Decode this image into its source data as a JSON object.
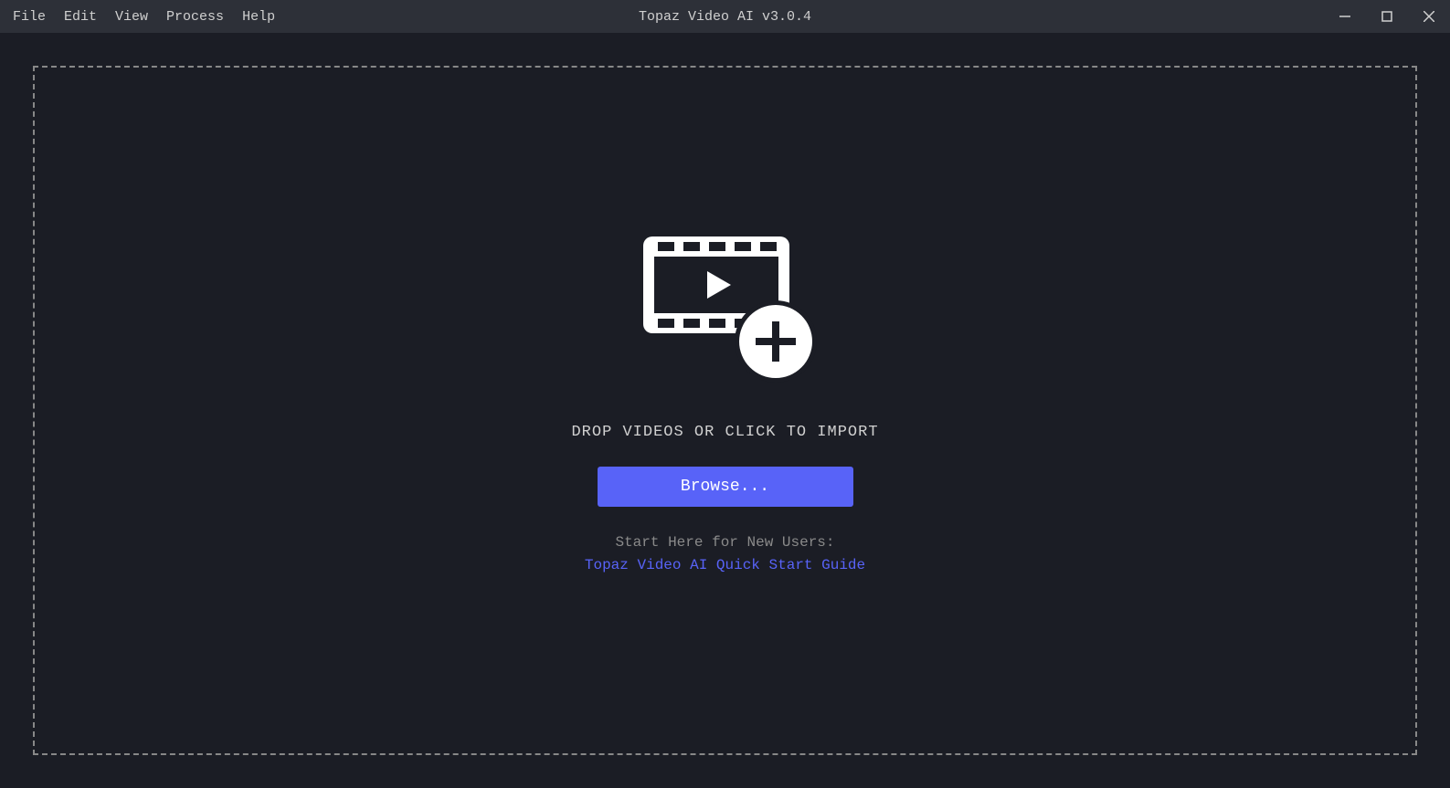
{
  "app": {
    "title": "Topaz Video AI  v3.0.4"
  },
  "menu": {
    "file": "File",
    "edit": "Edit",
    "view": "View",
    "process": "Process",
    "help": "Help"
  },
  "dropzone": {
    "text": "DROP VIDEOS OR CLICK TO IMPORT",
    "browse_label": "Browse...",
    "start_here": "Start Here for New Users:",
    "guide_label": "Topaz Video AI Quick Start Guide"
  }
}
